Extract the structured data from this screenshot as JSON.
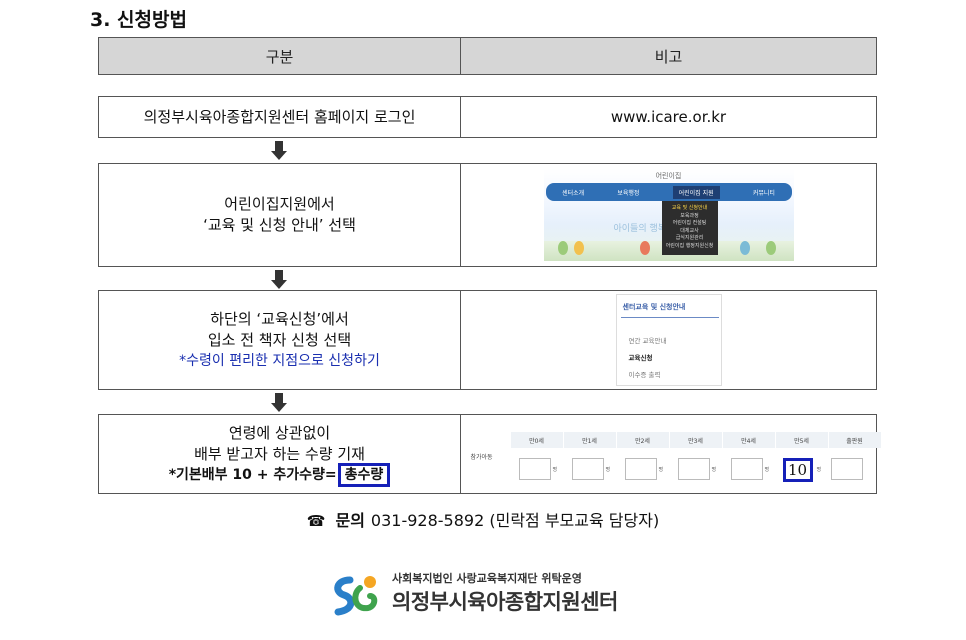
{
  "section": {
    "title": "3. 신청방법"
  },
  "table_header": {
    "col1": "구분",
    "col2": "비고"
  },
  "steps": [
    {
      "left_lines": [
        "의정부시육아종합지원센터 홈페이지 로그인"
      ],
      "right_text": "www.icare.or.kr"
    },
    {
      "left_lines": [
        "어린이집지원에서",
        "‘교육 및 신청 안내’ 선택"
      ]
    },
    {
      "left_lines": [
        "하단의 ‘교육신청’에서",
        "입소 전 책자 신청 선택"
      ],
      "note": "*수령이 편리한 지점으로 신청하기"
    },
    {
      "left_lines": [
        "연령에 상관없이",
        "배부 받고자 하는 수량 기재"
      ],
      "formula_prefix": "*기본배부 10 + 추가수량=",
      "formula_boxed": "총수량"
    }
  ],
  "thumb1": {
    "top_label": "어린이집",
    "nav": [
      "센터소개",
      "보육행정",
      "어린이집 지원",
      "커뮤니티"
    ],
    "dropdown": [
      "교육 및 신청안내",
      "보육과정",
      "어린이집 컨설팅",
      "대체교사",
      "급식지원관리",
      "어린이집 행정지원신청"
    ],
    "slogan": "아이들의 행복한 세상"
  },
  "thumb2": {
    "title": "센터교육 및 신청안내",
    "items": [
      "연간 교육안내",
      "교육신청",
      "이수증 출력"
    ],
    "selected_index": 1
  },
  "thumb3": {
    "row_label": "참가아동",
    "columns": [
      "만0세",
      "만1세",
      "만2세",
      "만3세",
      "만4세",
      "만5세",
      "출판원"
    ],
    "unit": "명",
    "filled_value": "10"
  },
  "contact": {
    "icon": "telephone-icon",
    "label": "문의",
    "text": "031-928-5892 (민락점 부모교육 담당자)"
  },
  "footer": {
    "sub": "사회복지법인 사랑교육복지재단 위탁운영",
    "name": "의정부시육아종합지원센터"
  },
  "colors": {
    "accent_blue": "#1520b8",
    "header_gray": "#d6d6d6",
    "nav_blue": "#2f6fb5"
  }
}
